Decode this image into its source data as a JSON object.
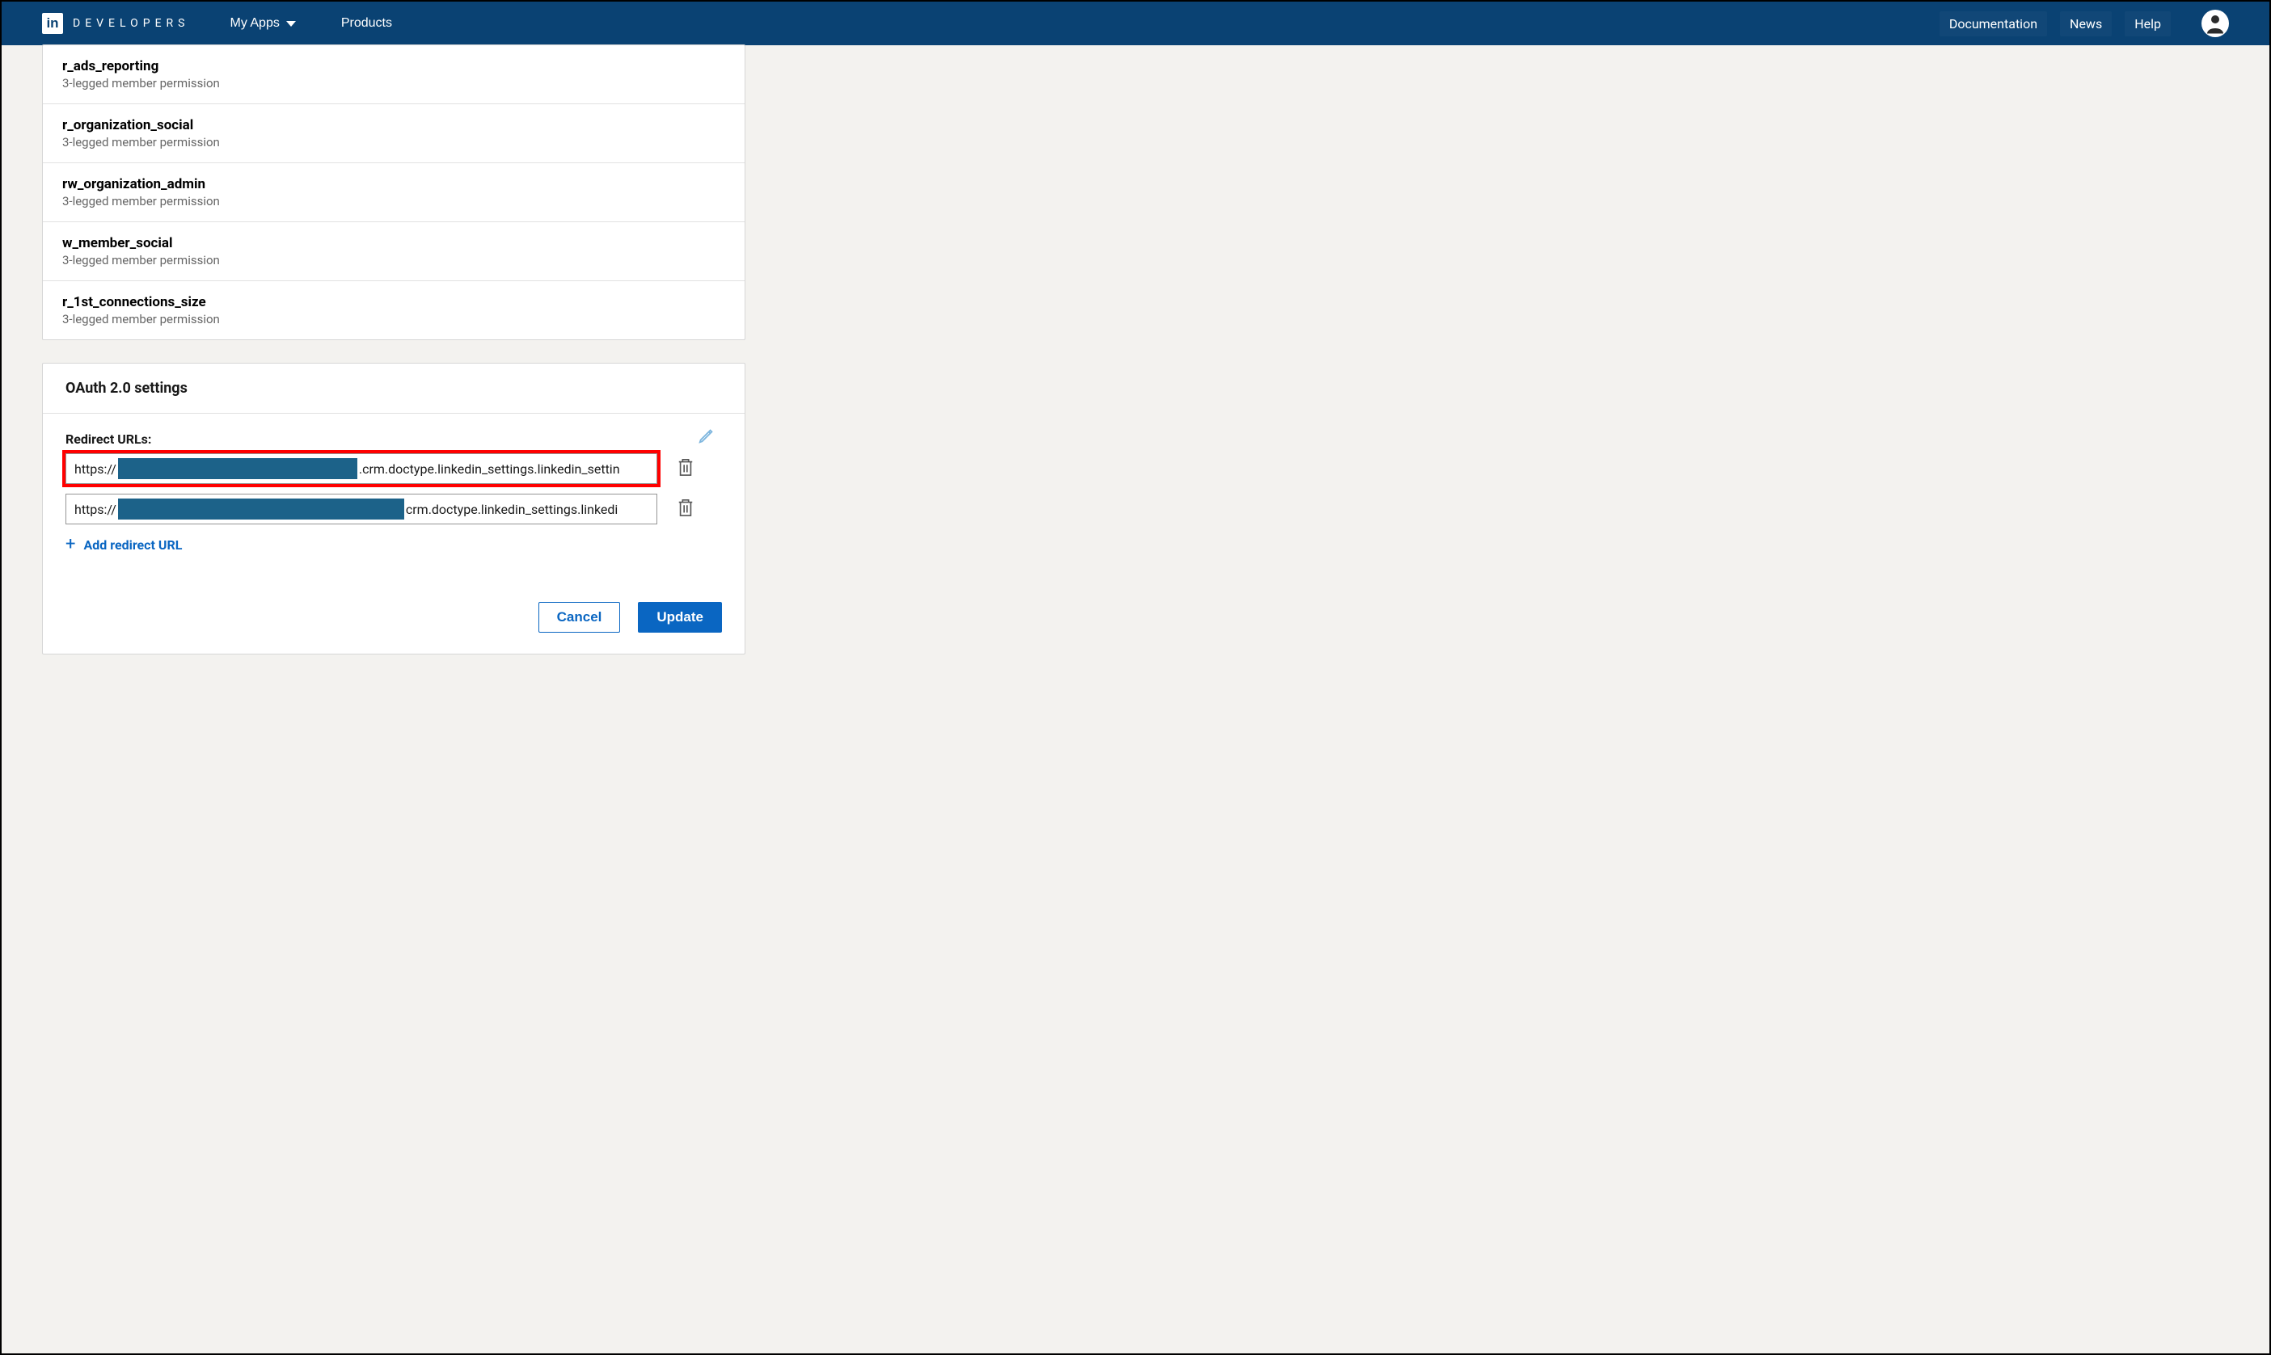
{
  "header": {
    "logo_badge": "in",
    "logo_text": "DEVELOPERS",
    "my_apps": "My Apps",
    "products": "Products",
    "documentation": "Documentation",
    "news": "News",
    "help": "Help"
  },
  "permissions": [
    {
      "name": "r_ads_reporting",
      "desc": "3-legged member permission"
    },
    {
      "name": "r_organization_social",
      "desc": "3-legged member permission"
    },
    {
      "name": "rw_organization_admin",
      "desc": "3-legged member permission"
    },
    {
      "name": "w_member_social",
      "desc": "3-legged member permission"
    },
    {
      "name": "r_1st_connections_size",
      "desc": "3-legged member permission"
    }
  ],
  "oauth": {
    "title": "OAuth 2.0 settings",
    "redirect_label": "Redirect URLs:",
    "urls": {
      "0": {
        "prefix": "https://",
        "suffix": ".crm.doctype.linkedin_settings.linkedin_settin"
      },
      "1": {
        "prefix": "https://",
        "suffix": "crm.doctype.linkedin_settings.linkedi"
      }
    },
    "add_label": "Add redirect URL",
    "cancel": "Cancel",
    "update": "Update"
  }
}
